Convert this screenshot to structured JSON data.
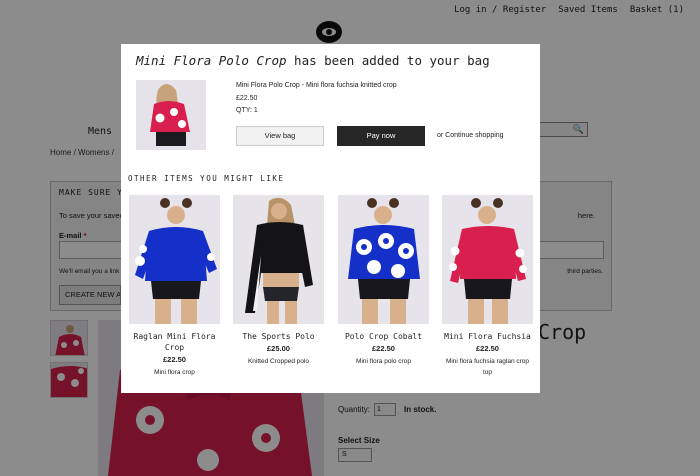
{
  "header": {
    "login_register": "Log in / Register",
    "saved_items": "Saved Items",
    "basket": "Basket (1)"
  },
  "nav": {
    "mens": "Mens"
  },
  "breadcrumb": {
    "home": "Home",
    "sep": "/",
    "womens": "Womens",
    "trail": "/"
  },
  "signup_panel": {
    "heading": "MAKE SURE Y",
    "intro": "To save your saved",
    "intro_right": "here.",
    "email_label": "E-mail",
    "required_mark": "*",
    "note": "We'll email you a link t",
    "note_right": "third parties.",
    "create_button": "CREATE NEW AC"
  },
  "product_page": {
    "title_partial": "Crop",
    "quantity_label": "Quantity:",
    "quantity_value": "1",
    "stock_status": "In stock.",
    "size_label": "Select Size",
    "size_value": "S"
  },
  "modal": {
    "added_product": "Mini Flora Polo Crop",
    "added_suffix": " has been added to your bag",
    "item_name": "Mini Flora Polo Crop - Mini flora fuchsia knitted crop",
    "item_price": "£22.50",
    "item_qty": "QTY: 1",
    "view_bag": "View bag",
    "pay_now": "Pay now",
    "continue": "or Continue shopping",
    "others_heading": "OTHER ITEMS YOU MIGHT LIKE",
    "recommendations": [
      {
        "name": "Raglan Mini Flora Crop",
        "price": "£22.50",
        "desc": "Mini flora crop"
      },
      {
        "name": "The Sports Polo",
        "price": "£25.00",
        "desc": "Knitted Cropped polo"
      },
      {
        "name": "Polo Crop Cobalt",
        "price": "£22.50",
        "desc": "Mini flora polo crop"
      },
      {
        "name": "Mini Flora Fuchsia",
        "price": "£22.50",
        "desc": "Mini flora fuchsia raglan crop top"
      }
    ]
  },
  "colors": {
    "overlay": "#000000",
    "pay_button": "#262626",
    "fuchsia": "#d81f4e",
    "cobalt": "#1530c8"
  }
}
